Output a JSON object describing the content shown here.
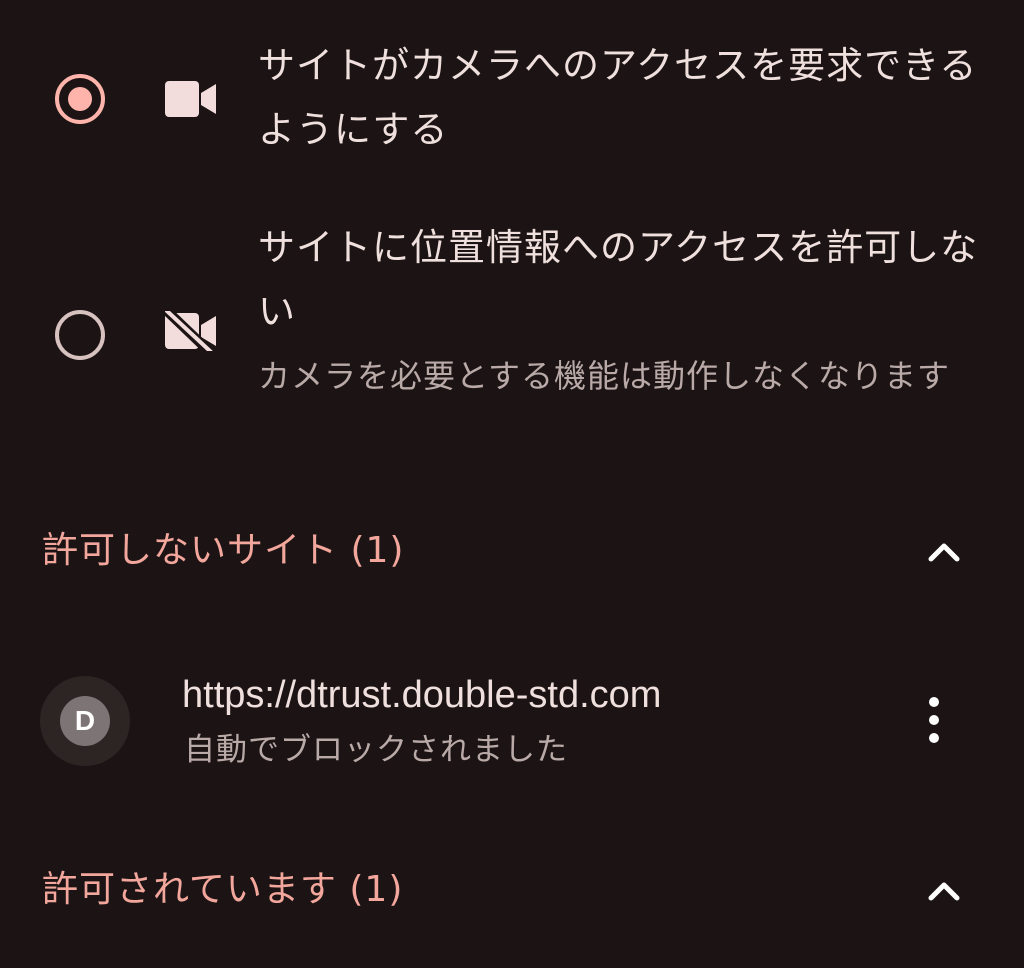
{
  "options": [
    {
      "title": "サイトがカメラへのアクセスを要求できるようにする",
      "selected": true,
      "icon": "camera-icon"
    },
    {
      "title": "サイトに位置情報へのアクセスを許可しない",
      "subtitle": "カメラを必要とする機能は動作しなくなります",
      "selected": false,
      "icon": "camera-off-icon"
    }
  ],
  "blocked_section": {
    "title": "許可しないサイト (1)",
    "icon": "chevron-up-icon",
    "sites": [
      {
        "favicon_letter": "D",
        "url": "https://dtrust.double-std.com",
        "status": "自動でブロックされました"
      }
    ]
  },
  "allowed_section": {
    "title": "許可されています (1)",
    "icon": "chevron-up-icon"
  },
  "colors": {
    "background": "#1c1414",
    "accent": "#ffb4ab",
    "section_header": "#f2a69c"
  }
}
